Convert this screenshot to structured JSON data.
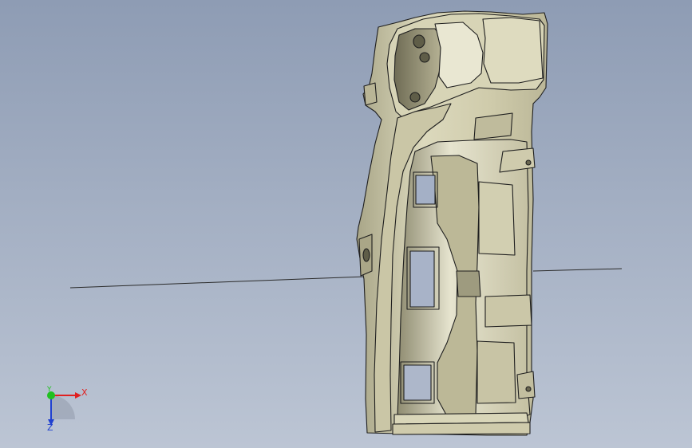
{
  "viewport": {
    "background_top": "#8e9cb4",
    "background_bottom": "#bcc5d4"
  },
  "model": {
    "body_color": "#d9d6b5",
    "edge_color": "#1e1e1e"
  },
  "triad": {
    "x_label": "X",
    "y_label": "Y",
    "z_label": "Z",
    "x_color": "#e02020",
    "y_color": "#20c020",
    "z_color": "#2040d0"
  }
}
